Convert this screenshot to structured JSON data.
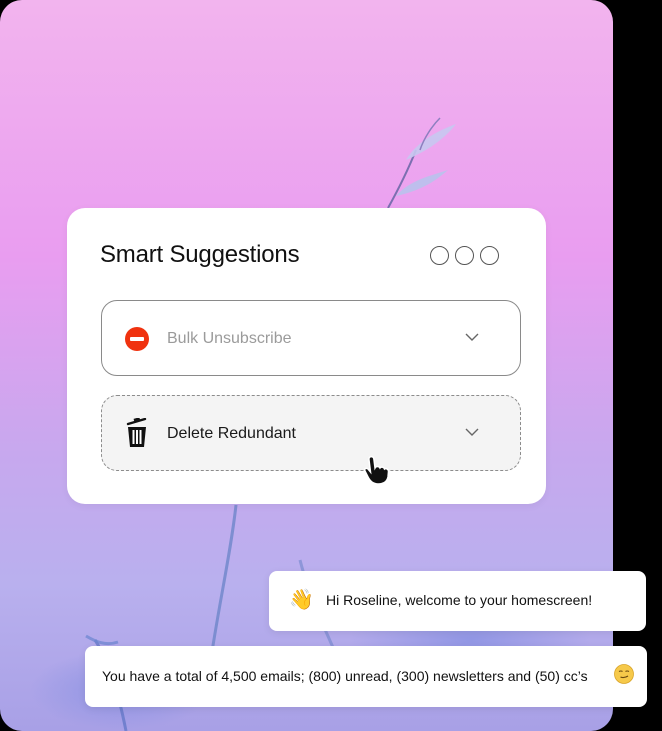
{
  "card": {
    "title": "Smart Suggestions",
    "window_controls": [
      "circle",
      "circle",
      "circle"
    ],
    "options": [
      {
        "label": "Bulk Unsubscribe",
        "icon": "no-entry-icon",
        "state": "inactive"
      },
      {
        "label": "Delete Redundant",
        "icon": "trash-icon",
        "state": "hovered"
      }
    ]
  },
  "messages": {
    "greeting": {
      "emoji": "👋",
      "text": "Hi Roseline, welcome to your homescreen!"
    },
    "summary": {
      "text": "You have a total of 4,500 emails; (800) unread, (300) newsletters and (50) cc’s",
      "emoji": "smirking-face-icon"
    }
  },
  "colors": {
    "no_entry_red": "#f0320f",
    "background_pink": "#e99df0",
    "background_lilac": "#b9b0ee"
  }
}
